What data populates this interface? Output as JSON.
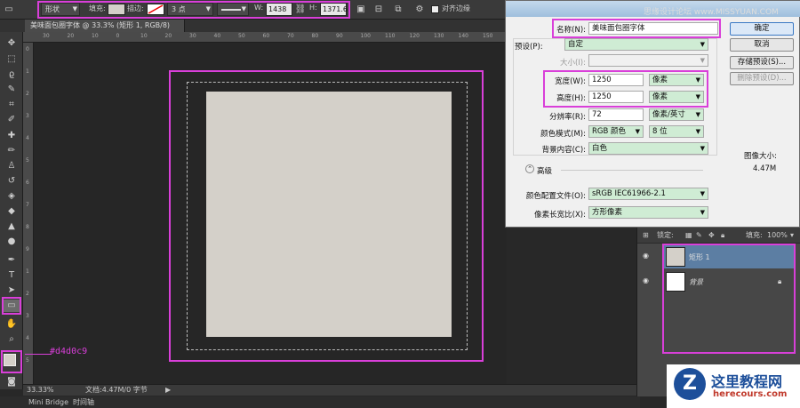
{
  "options_bar": {
    "mode": "形状",
    "fill_label": "填充:",
    "stroke_label": "描边:",
    "stroke_size": "3 点",
    "w_label": "W:",
    "w_value": "1438 像",
    "h_label": "H:",
    "h_value": "1371.6",
    "align_edges": "对齐边缘"
  },
  "document_tab": "美味面包圈字体 @ 33.3% (矩形 1, RGB/8) *",
  "ruler_h": [
    "30",
    "20",
    "10",
    "0",
    "10",
    "20",
    "30",
    "40",
    "50",
    "60",
    "70",
    "80",
    "90",
    "100",
    "110",
    "120",
    "130",
    "140",
    "150"
  ],
  "ruler_v": [
    "0",
    "1",
    "2",
    "3",
    "4",
    "5",
    "6",
    "7",
    "8",
    "9",
    "1",
    "2",
    "3",
    "4",
    "5"
  ],
  "canvas": {
    "rect_color": "#d4d0c9",
    "annotation": "#d4d0c9"
  },
  "status": {
    "zoom": "33.33%",
    "doc": "文档:4.47M/0 字节"
  },
  "bottom_tabs": [
    "Mini Bridge",
    "时间轴"
  ],
  "watermark_top": "思缘设计论坛 www.MISSYUAN.COM",
  "dialog": {
    "name_label": "名称(N):",
    "name_value": "美味面包圈字体",
    "preset_label": "预设(P):",
    "preset_value": "自定",
    "size_label": "大小(I):",
    "width_label": "宽度(W):",
    "width_value": "1250",
    "width_unit": "像素",
    "height_label": "高度(H):",
    "height_value": "1250",
    "height_unit": "像素",
    "resolution_label": "分辨率(R):",
    "resolution_value": "72",
    "resolution_unit": "像素/英寸",
    "color_mode_label": "颜色模式(M):",
    "color_mode_value": "RGB 颜色",
    "bit_depth": "8 位",
    "bg_label": "背景内容(C):",
    "bg_value": "白色",
    "advanced_label": "高级",
    "profile_label": "颜色配置文件(O):",
    "profile_value": "sRGB IEC61966-2.1",
    "aspect_label": "像素长宽比(X):",
    "aspect_value": "方形像素",
    "ok": "确定",
    "cancel": "取消",
    "save_preset": "存储预设(S)...",
    "delete_preset": "删除预设(D)...",
    "image_size_label": "图像大小:",
    "image_size_value": "4.47M"
  },
  "layers": {
    "lock_label": "锁定:",
    "fill_label": "填充:",
    "fill_value": "100%",
    "items": [
      {
        "name": "矩形 1"
      },
      {
        "name": "背景"
      }
    ]
  },
  "logo": {
    "name": "这里教程网",
    "url": "herecours.com"
  }
}
